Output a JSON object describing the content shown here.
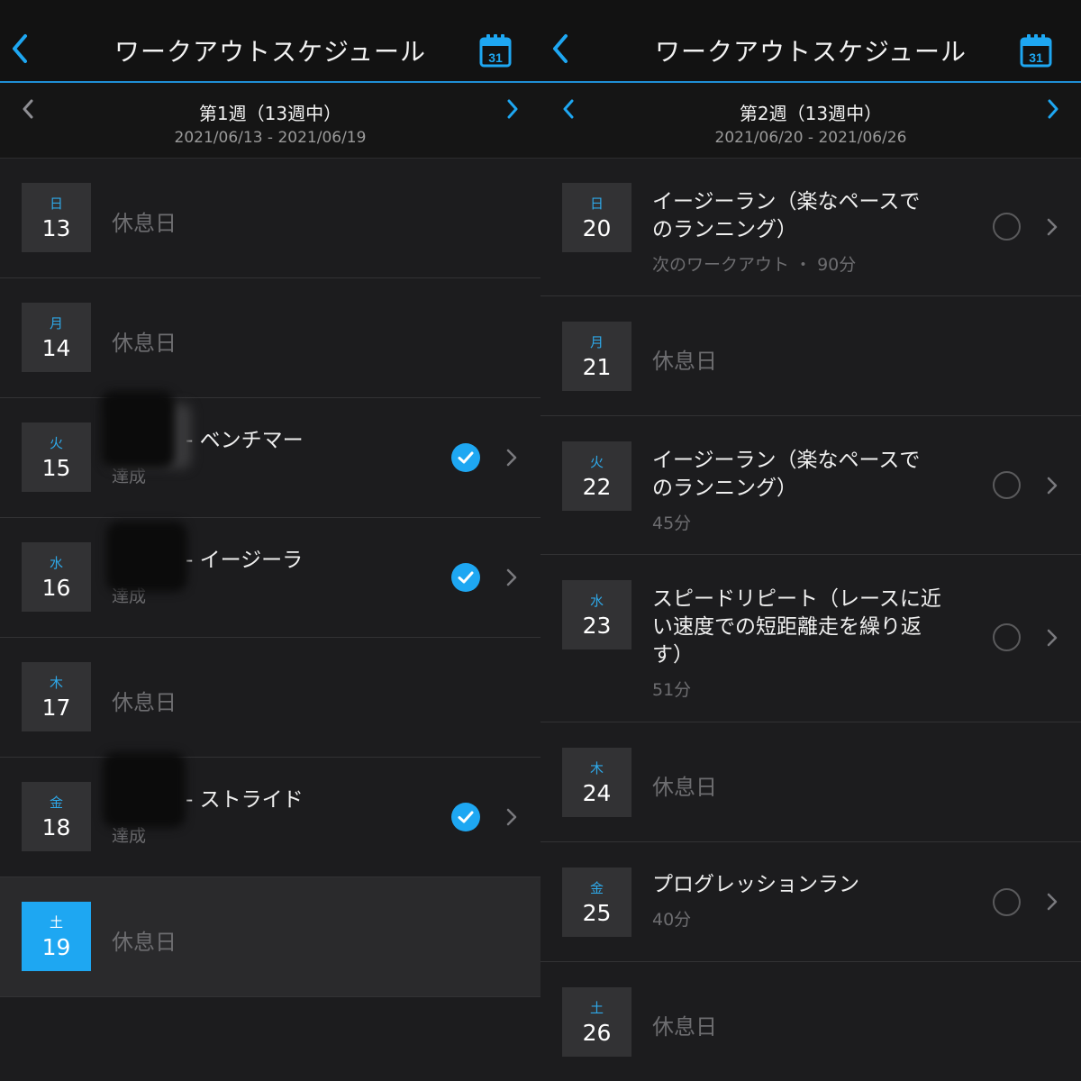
{
  "colors": {
    "accent": "#1ea7f2",
    "background": "#1c1c1e",
    "header": "#121212",
    "muted": "#6d6d70",
    "date_tile": "#323234"
  },
  "left": {
    "header": {
      "title": "ワークアウトスケジュール",
      "calendar_icon_label": "31"
    },
    "week": {
      "title": "第1週（13週中）",
      "range": "2021/06/13 - 2021/06/19"
    },
    "days": [
      {
        "dow": "日",
        "day": "13",
        "rest": "休息日"
      },
      {
        "dow": "月",
        "day": "14",
        "rest": "休息日"
      },
      {
        "dow": "火",
        "day": "15",
        "name": "- ベンチマー",
        "sub": "達成",
        "status": "done"
      },
      {
        "dow": "水",
        "day": "16",
        "name": "- イージーラ",
        "sub": "達成",
        "status": "done"
      },
      {
        "dow": "木",
        "day": "17",
        "rest": "休息日"
      },
      {
        "dow": "金",
        "day": "18",
        "name": "- ストライド",
        "sub": "達成",
        "status": "done"
      },
      {
        "dow": "土",
        "day": "19",
        "rest": "休息日",
        "today": true
      }
    ]
  },
  "right": {
    "header": {
      "title": "ワークアウトスケジュール",
      "calendar_icon_label": "31"
    },
    "week": {
      "title": "第2週（13週中）",
      "range": "2021/06/20 - 2021/06/26"
    },
    "days": [
      {
        "dow": "日",
        "day": "20",
        "name_line1": "イージーラン（楽なペースで",
        "name_line2": "のランニング）",
        "sub": "次のワークアウト ・ 90分",
        "status": "pending"
      },
      {
        "dow": "月",
        "day": "21",
        "rest": "休息日"
      },
      {
        "dow": "火",
        "day": "22",
        "name_line1": "イージーラン（楽なペースで",
        "name_line2": "のランニング）",
        "sub": "45分",
        "status": "pending"
      },
      {
        "dow": "水",
        "day": "23",
        "name_line1": "スピードリピート（レースに近",
        "name_line2": "い速度での短距離走を繰り返",
        "name_line3": "す）",
        "sub": "51分",
        "status": "pending"
      },
      {
        "dow": "木",
        "day": "24",
        "rest": "休息日"
      },
      {
        "dow": "金",
        "day": "25",
        "name_line1": "プログレッションラン",
        "sub": "40分",
        "status": "pending"
      },
      {
        "dow": "土",
        "day": "26",
        "rest": "休息日"
      }
    ]
  }
}
